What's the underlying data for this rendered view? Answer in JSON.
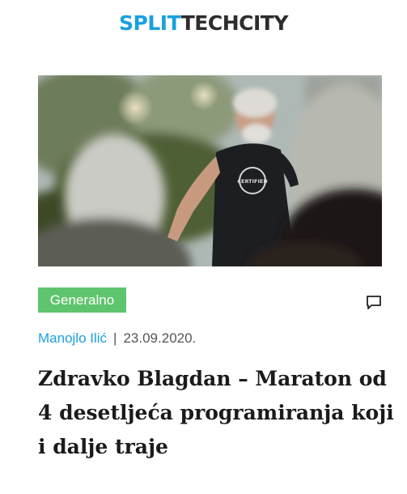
{
  "logo": {
    "part1": "SPLIT",
    "part2": "TECHCITY"
  },
  "article": {
    "image_alt": "Zdravko Blagdan govori pred publikom",
    "category": "Generalno",
    "author": "Manojlo Ilić",
    "separator": "|",
    "date": "23.09.2020.",
    "title": "Zdravko Blagdan – Maraton od 4 desetljeća programiranja koji i dalje traje",
    "shirt_text": "CERTIFIED"
  },
  "colors": {
    "accent": "#1aa0e0",
    "tag_bg": "#5fc46e",
    "logo_dark": "#2d2d2d"
  },
  "icons": {
    "comment": "comment-icon"
  }
}
